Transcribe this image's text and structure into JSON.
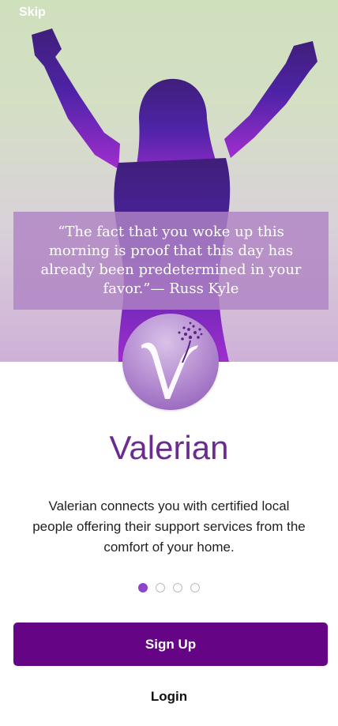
{
  "header": {
    "skip_label": "Skip"
  },
  "hero": {
    "quote": "“The fact that you woke up this morning is proof that this day has already been predetermined in your favor.”— Russ Kyle"
  },
  "brand": {
    "logo_icon": "valerian-flower-logo-icon",
    "name": "Valerian",
    "accent_color": "#6b2c90"
  },
  "onboarding": {
    "description": "Valerian connects you with certified local people offering their support services from the comfort of your home.",
    "pager": {
      "total": 4,
      "active_index": 0
    }
  },
  "actions": {
    "signup_label": "Sign Up",
    "login_label": "Login",
    "signup_color": "#650586"
  }
}
